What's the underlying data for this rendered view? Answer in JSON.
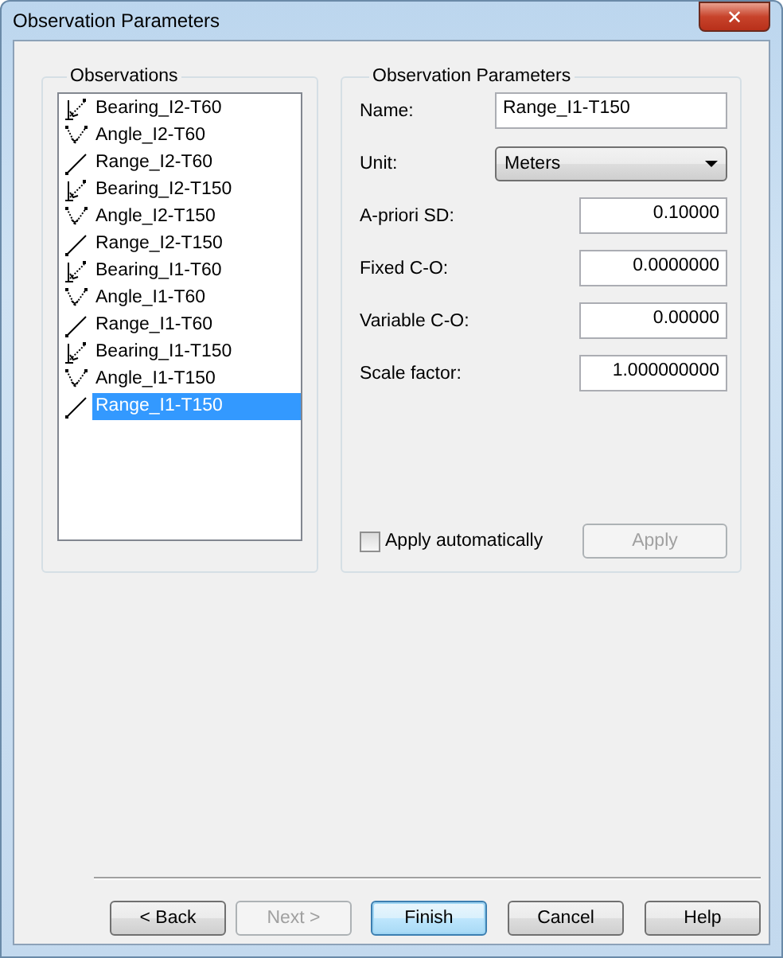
{
  "window": {
    "title": "Observation Parameters",
    "close": "✕"
  },
  "observations": {
    "title": "Observations",
    "items": [
      {
        "kind": "bearing",
        "label": "Bearing_I2-T60",
        "selected": false
      },
      {
        "kind": "angle",
        "label": "Angle_I2-T60",
        "selected": false
      },
      {
        "kind": "range",
        "label": "Range_I2-T60",
        "selected": false
      },
      {
        "kind": "bearing",
        "label": "Bearing_I2-T150",
        "selected": false
      },
      {
        "kind": "angle",
        "label": "Angle_I2-T150",
        "selected": false
      },
      {
        "kind": "range",
        "label": "Range_I2-T150",
        "selected": false
      },
      {
        "kind": "bearing",
        "label": "Bearing_I1-T60",
        "selected": false
      },
      {
        "kind": "angle",
        "label": "Angle_I1-T60",
        "selected": false
      },
      {
        "kind": "range",
        "label": "Range_I1-T60",
        "selected": false
      },
      {
        "kind": "bearing",
        "label": "Bearing_I1-T150",
        "selected": false
      },
      {
        "kind": "angle",
        "label": "Angle_I1-T150",
        "selected": false
      },
      {
        "kind": "range",
        "label": "Range_I1-T150",
        "selected": true
      }
    ]
  },
  "parameters": {
    "title": "Observation Parameters",
    "fields": [
      {
        "kind": "text",
        "label": "Name:",
        "value": "Range_I1-T150"
      },
      {
        "kind": "select",
        "label": "Unit:",
        "value": "Meters"
      },
      {
        "kind": "number",
        "label": "A-priori SD:",
        "value": "0.10000"
      },
      {
        "kind": "number",
        "label": "Fixed C-O:",
        "value": "0.0000000"
      },
      {
        "kind": "number",
        "label": "Variable C-O:",
        "value": "0.00000"
      },
      {
        "kind": "number",
        "label": "Scale factor:",
        "value": "1.000000000"
      }
    ],
    "apply_automatically": {
      "label": "Apply automatically",
      "checked": false
    },
    "apply_button": {
      "label": "Apply",
      "disabled": true
    }
  },
  "buttons": [
    {
      "label": "< Back",
      "disabled": false,
      "default": false
    },
    {
      "label": "Next >",
      "disabled": true,
      "default": false
    },
    {
      "label": "Finish",
      "disabled": false,
      "default": true
    },
    {
      "label": "Cancel",
      "disabled": false,
      "default": false
    },
    {
      "label": "Help",
      "disabled": false,
      "default": false
    }
  ]
}
